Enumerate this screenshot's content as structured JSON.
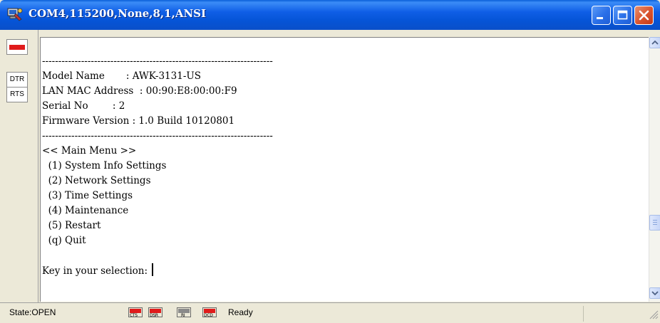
{
  "window": {
    "title": "COM4,115200,None,8,1,ANSI"
  },
  "signals": {
    "left_buttons": [
      "DTR",
      "RTS"
    ]
  },
  "terminal": {
    "lines": [
      "-----------------------------------------------------------------------",
      "Model Name       : AWK-3131-US",
      "LAN MAC Address  : 00:90:E8:00:00:F9",
      "Serial No        : 2",
      "Firmware Version : 1.0 Build 10120801",
      "-----------------------------------------------------------------------",
      "<< Main Menu >>",
      "  (1) System Info Settings",
      "  (2) Network Settings",
      "  (3) Time Settings",
      "  (4) Maintenance",
      "  (5) Restart",
      "  (q) Quit",
      "",
      "Key in your selection: "
    ]
  },
  "status": {
    "state": "State:OPEN",
    "lamps": [
      {
        "label": "CTS",
        "on": true
      },
      {
        "label": "DSR",
        "on": true
      },
      {
        "label": "RI",
        "on": false
      },
      {
        "label": "DCD",
        "on": true
      }
    ],
    "ready": "Ready"
  },
  "colors": {
    "titlebar": "#0554d6",
    "signal_on": "#e01b1b",
    "signal_off": "#8a8a8a"
  }
}
